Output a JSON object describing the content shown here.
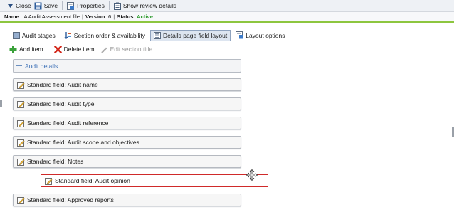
{
  "toolbar": {
    "close_label": "Close",
    "save_label": "Save",
    "properties_label": "Properties",
    "review_label": "Show review details"
  },
  "info": {
    "name_key": "Name:",
    "name_value": "IA Audit Assessment file",
    "version_key": "Version:",
    "version_value": "6",
    "status_key": "Status:",
    "status_value": "Active",
    "separator": "|"
  },
  "tabs": [
    {
      "label": "Audit stages",
      "icon": "list-icon"
    },
    {
      "label": "Section order & availability",
      "icon": "sort-icon"
    },
    {
      "label": "Details page field layout",
      "icon": "layout-icon",
      "active": true
    },
    {
      "label": "Layout options",
      "icon": "options-icon"
    }
  ],
  "actions": {
    "add_label": "Add item...",
    "delete_label": "Delete item",
    "edit_label": "Edit section title"
  },
  "section": {
    "title": "Audit details"
  },
  "fields": [
    "Standard field: Audit name",
    "Standard field: Audit type",
    "Standard field: Audit reference",
    "Standard field: Audit scope and objectives",
    "Standard field: Notes",
    "Standard field: Audit opinion",
    "Standard field: Approved reports"
  ],
  "colors": {
    "status_active": "#2e9b2e",
    "accent_bar": "#8dc63f",
    "drag_border": "#d02a2a",
    "section_title": "#3b6fb6"
  }
}
